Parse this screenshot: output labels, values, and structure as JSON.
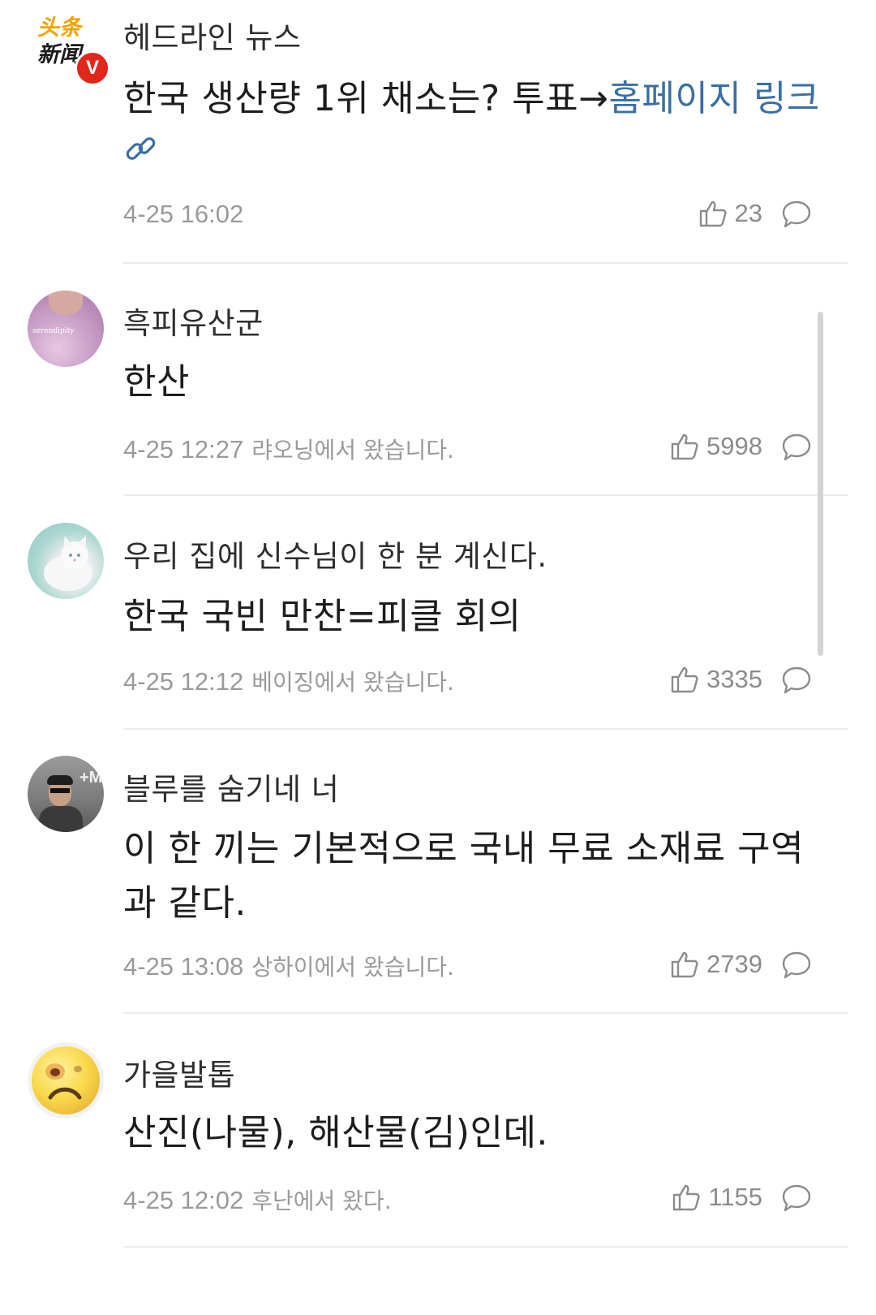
{
  "colors": {
    "link": "#3b6fa3",
    "muted": "#9a9a9a",
    "divider": "#ececec",
    "badge": "#e1261c"
  },
  "post": {
    "logo_text_1": "头条",
    "logo_text_2": "新闻",
    "badge": "V",
    "author": "헤드라인 뉴스",
    "text": "한국 생산량 1위 채소는? 투표→",
    "link_text": "홈페이지 링크",
    "time": "4-25 16:02",
    "likes": "23"
  },
  "comments": [
    {
      "avatar_text": "serendipity",
      "name": "흑피유산군",
      "text": "한산",
      "time": "4-25 12:27",
      "location": "랴오닝에서 왔습니다.",
      "likes": "5998"
    },
    {
      "name": "우리 집에 신수님이 한 분 계신다.",
      "text": "한국 국빈 만찬=피클 회의",
      "time": "4-25 12:12",
      "location": "베이징에서 왔습니다.",
      "likes": "3335"
    },
    {
      "avatar_text": "+M",
      "name": "블루를 숨기네 너",
      "text": "이 한 끼는 기본적으로 국내 무료 소재료 구역과 같다.",
      "time": "4-25 13:08",
      "location": "상하이에서 왔습니다.",
      "likes": "2739"
    },
    {
      "name": "가을발톱",
      "text": "산진(나물), 해산물(김)인데.",
      "time": "4-25 12:02",
      "location": "후난에서 왔다.",
      "likes": "1155"
    }
  ]
}
